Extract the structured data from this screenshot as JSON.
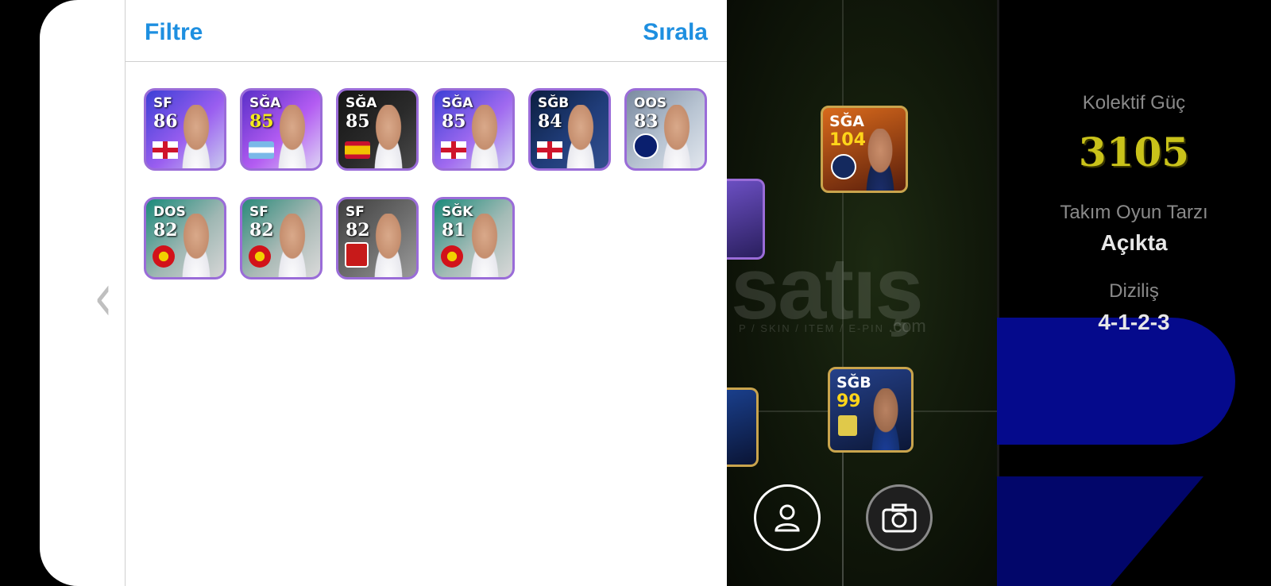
{
  "header": {
    "filter_label": "Filtre",
    "sort_label": "Sırala"
  },
  "cards": [
    {
      "position": "SF",
      "rating": "86",
      "rating_color": "#ffffff",
      "badge": "england-flag"
    },
    {
      "position": "SĞA",
      "rating": "85",
      "rating_color": "#f4ea1c",
      "badge": "argentina-flag"
    },
    {
      "position": "SĞA",
      "rating": "85",
      "rating_color": "#ffffff",
      "badge": "spain-flag"
    },
    {
      "position": "SĞA",
      "rating": "85",
      "rating_color": "#ffffff",
      "badge": "england-flag"
    },
    {
      "position": "SĞB",
      "rating": "84",
      "rating_color": "#ffffff",
      "badge": "england-flag"
    },
    {
      "position": "OOS",
      "rating": "83",
      "rating_color": "#ffffff",
      "badge": "inter-crest"
    },
    {
      "position": "DOS",
      "rating": "82",
      "rating_color": "#ffffff",
      "badge": "man-utd-crest"
    },
    {
      "position": "SF",
      "rating": "82",
      "rating_color": "#ffffff",
      "badge": "man-utd-crest"
    },
    {
      "position": "SF",
      "rating": "82",
      "rating_color": "#ffffff",
      "badge": "club-crest"
    },
    {
      "position": "SĞK",
      "rating": "81",
      "rating_color": "#ffffff",
      "badge": "man-utd-crest"
    }
  ],
  "pitch_cards": [
    {
      "position": "SĞA",
      "rating": "104"
    },
    {
      "position": "SĞB",
      "rating": "99"
    }
  ],
  "watermark": {
    "text": "satış",
    "sub": "P / SKIN / ITEM / E-PIN",
    "domain": ".com"
  },
  "team_stats": {
    "collective_label": "Kolektif Güç",
    "collective_value": "3105",
    "playstyle_label": "Takım Oyun Tarzı",
    "playstyle_value": "Açıkta",
    "formation_label": "Diziliş",
    "formation_value": "4-1-2-3"
  },
  "colors": {
    "accent": "#1e8fe0",
    "gold": "#c9c21a",
    "card_border": "#9a6cd8"
  },
  "icons": {
    "back": "chevron-left-icon",
    "profile": "person-icon",
    "camera": "camera-icon"
  }
}
